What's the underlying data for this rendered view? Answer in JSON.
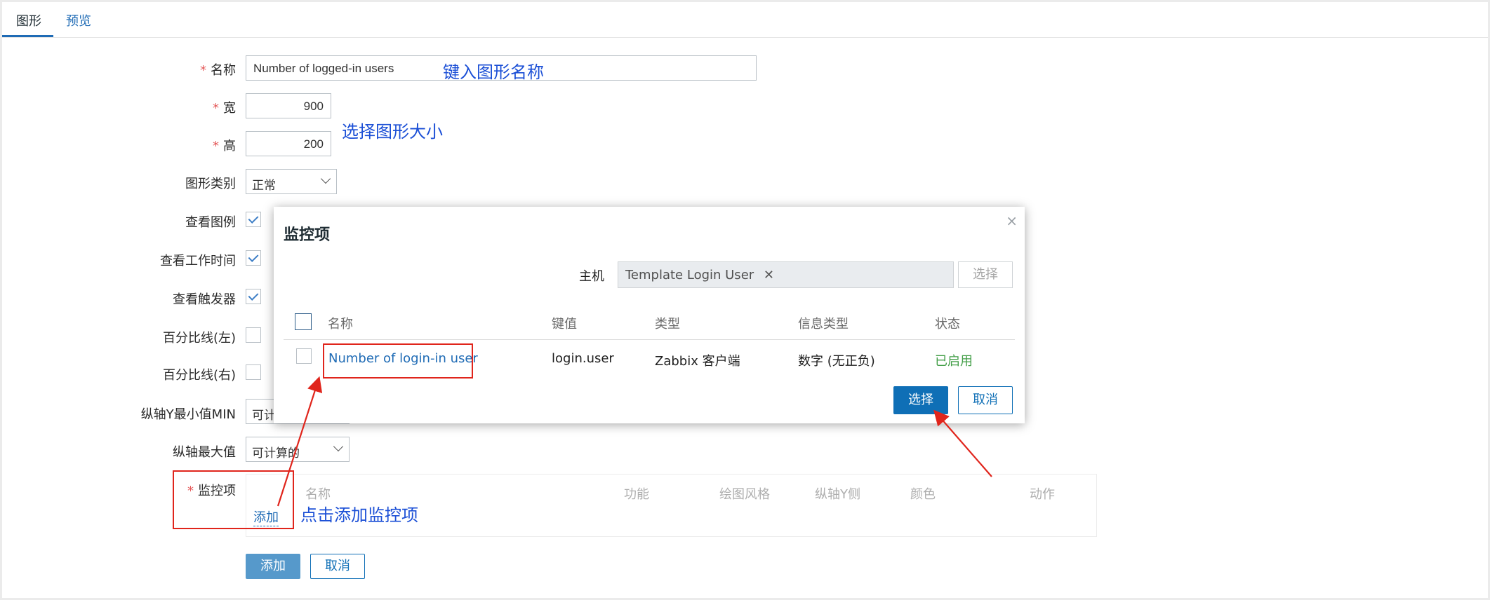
{
  "tabs": [
    "图形",
    "预览"
  ],
  "form": {
    "name_label": "名称",
    "name_value": "Number of logged-in users",
    "name_note": "键入图形名称",
    "width_label": "宽",
    "width_value": "900",
    "height_label": "高",
    "height_value": "200",
    "size_note": "选择图形大小",
    "graph_type_label": "图形类别",
    "graph_type_value": "正常",
    "show_legend_label": "查看图例",
    "show_worktime_label": "查看工作时间",
    "show_triggers_label": "查看触发器",
    "percentile_left_label": "百分比线(左)",
    "percentile_right_label": "百分比线(右)",
    "ymin_label": "纵轴Y最小值MIN",
    "ymin_value": "可计",
    "ymax_label": "纵轴最大值",
    "ymax_value": "可计算的",
    "items_label": "监控项",
    "items_headers": [
      "名称",
      "功能",
      "绘图风格",
      "纵轴Y侧",
      "颜色",
      "动作"
    ],
    "items_add_link": "添加",
    "items_note": "点击添加监控项",
    "add_button": "添加",
    "cancel_button": "取消"
  },
  "modal": {
    "title": "监控项",
    "host_label": "主机",
    "host_tag": "Template Login User",
    "host_select_button": "选择",
    "columns": [
      "名称",
      "键值",
      "类型",
      "信息类型",
      "状态"
    ],
    "row": {
      "name": "Number of login-in user",
      "key": "login.user",
      "type": "Zabbix 客户端",
      "info_type": "数字 (无正负)",
      "status": "已启用"
    },
    "select_button": "选择",
    "cancel_button": "取消"
  },
  "colors": {
    "link": "#1f6bb5",
    "primary": "#0f6fb6",
    "annotation": "#1b4fd6",
    "highlight": "#e0251c",
    "status_enabled": "#429e47"
  }
}
